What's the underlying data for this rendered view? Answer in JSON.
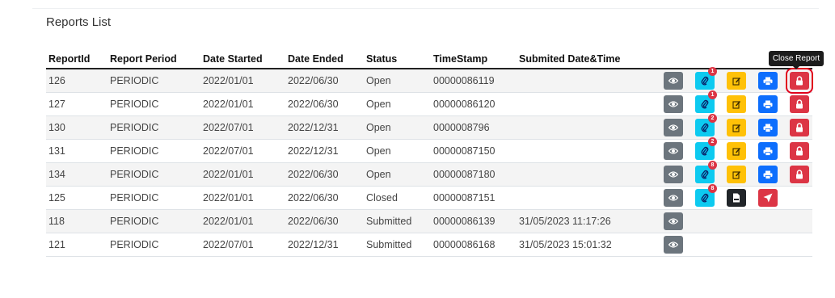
{
  "page": {
    "title": "Reports List"
  },
  "table": {
    "headers": [
      "ReportId",
      "Report Period",
      "Date Started",
      "Date Ended",
      "Status",
      "TimeStamp",
      "Submited Date&Time"
    ],
    "rows": [
      {
        "id": "126",
        "period": "PERIODIC",
        "started": "2022/01/01",
        "ended": "2022/06/30",
        "status": "Open",
        "timestamp": "00000086119",
        "submitted": "",
        "attachments": "1"
      },
      {
        "id": "127",
        "period": "PERIODIC",
        "started": "2022/01/01",
        "ended": "2022/06/30",
        "status": "Open",
        "timestamp": "00000086120",
        "submitted": "",
        "attachments": "1"
      },
      {
        "id": "130",
        "period": "PERIODIC",
        "started": "2022/07/01",
        "ended": "2022/12/31",
        "status": "Open",
        "timestamp": "0000008796",
        "submitted": "",
        "attachments": "2"
      },
      {
        "id": "131",
        "period": "PERIODIC",
        "started": "2022/07/01",
        "ended": "2022/12/31",
        "status": "Open",
        "timestamp": "00000087150",
        "submitted": "",
        "attachments": "2"
      },
      {
        "id": "134",
        "period": "PERIODIC",
        "started": "2022/01/01",
        "ended": "2022/06/30",
        "status": "Open",
        "timestamp": "00000087180",
        "submitted": "",
        "attachments": "8"
      },
      {
        "id": "125",
        "period": "PERIODIC",
        "started": "2022/01/01",
        "ended": "2022/06/30",
        "status": "Closed",
        "timestamp": "00000087151",
        "submitted": "",
        "attachments": "8"
      },
      {
        "id": "118",
        "period": "PERIODIC",
        "started": "2022/01/01",
        "ended": "2022/06/30",
        "status": "Submitted",
        "timestamp": "00000086139",
        "submitted": "31/05/2023 11:17:26",
        "attachments": ""
      },
      {
        "id": "121",
        "period": "PERIODIC",
        "started": "2022/07/01",
        "ended": "2022/12/31",
        "status": "Submitted",
        "timestamp": "00000086168",
        "submitted": "31/05/2023 15:01:32",
        "attachments": ""
      }
    ]
  },
  "tooltip": {
    "label": "Close Report"
  },
  "colors": {
    "view": "#6c757d",
    "attachment": "#0dcaf0",
    "edit": "#ffc107",
    "print": "#0d6efd",
    "close": "#dc3545",
    "pdf": "#212529",
    "send": "#dc3545",
    "highlight": "#e0001b"
  },
  "icons": {
    "view": "eye-icon",
    "attachment": "paperclip-icon",
    "edit": "edit-icon",
    "print": "printer-icon",
    "close": "lock-icon",
    "pdf": "pdf-file-icon",
    "send": "send-icon"
  }
}
